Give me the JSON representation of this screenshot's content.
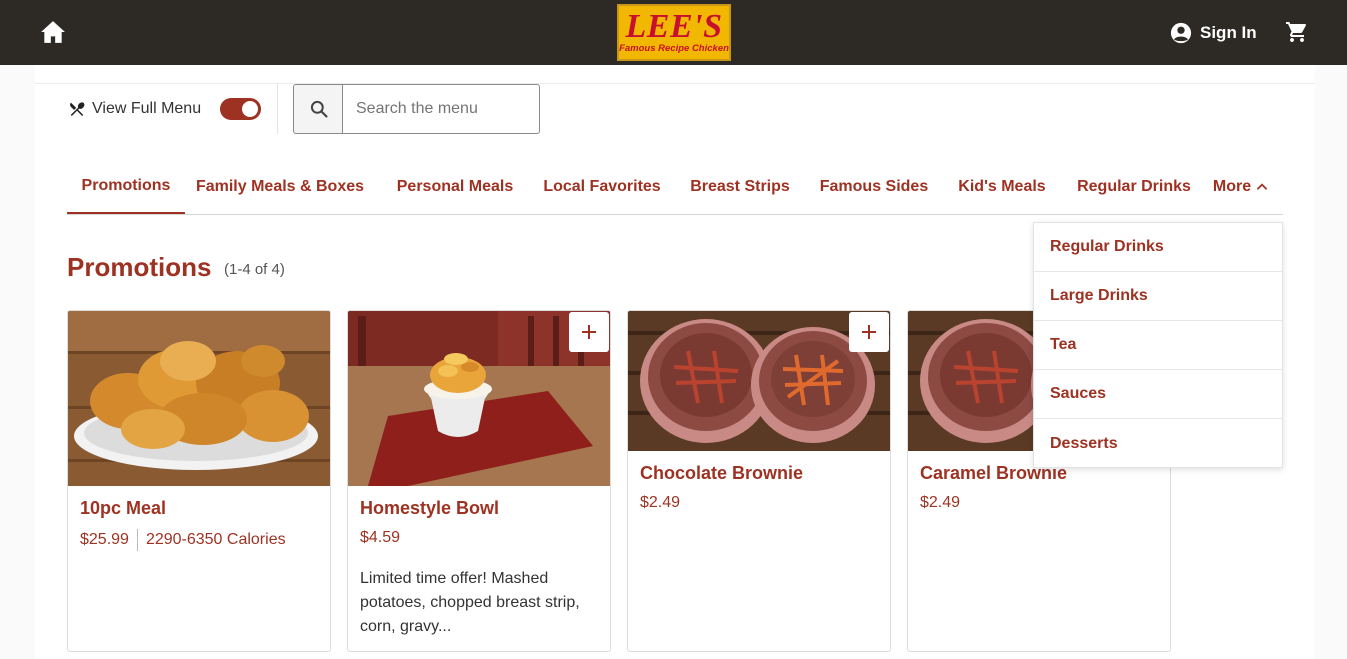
{
  "header": {
    "home_icon": "home-icon",
    "logo_main": "LEE'S",
    "logo_sub": "Famous Recipe Chicken",
    "signin_label": "Sign In",
    "account_icon": "account-circle-icon",
    "cart_icon": "cart-icon"
  },
  "controls": {
    "view_full_menu_label": "View Full Menu",
    "view_full_menu_on": true,
    "search_placeholder": "Search the menu"
  },
  "tabs": [
    {
      "label": "Promotions",
      "active": true
    },
    {
      "label": "Family Meals & Boxes"
    },
    {
      "label": "Personal Meals"
    },
    {
      "label": "Local Favorites"
    },
    {
      "label": "Breast Strips"
    },
    {
      "label": "Famous Sides"
    },
    {
      "label": "Kid's Meals"
    },
    {
      "label": "Regular Drinks"
    },
    {
      "label": "More"
    }
  ],
  "more_dropdown": [
    "Regular Drinks",
    "Large Drinks",
    "Tea",
    "Sauces",
    "Desserts"
  ],
  "section": {
    "title": "Promotions",
    "count": "(1-4 of 4)"
  },
  "cards": [
    {
      "name": "10pc Meal",
      "price": "$25.99",
      "calories": "2290-6350 Calories",
      "image": "fried-chicken-plate"
    },
    {
      "name": "Homestyle Bowl",
      "price": "$4.59",
      "description": "Limited time offer! Mashed potatoes, chopped breast strip, corn, gravy...",
      "image": "homestyle-bowl"
    },
    {
      "name": "Chocolate Brownie",
      "price": "$2.49",
      "image": "brownies"
    },
    {
      "name": "Caramel Brownie",
      "price": "$2.49",
      "image": "brownies"
    }
  ],
  "colors": {
    "brand": "#9e3222",
    "header_bg": "#2d2a26",
    "logo_bg": "#f2b700"
  }
}
